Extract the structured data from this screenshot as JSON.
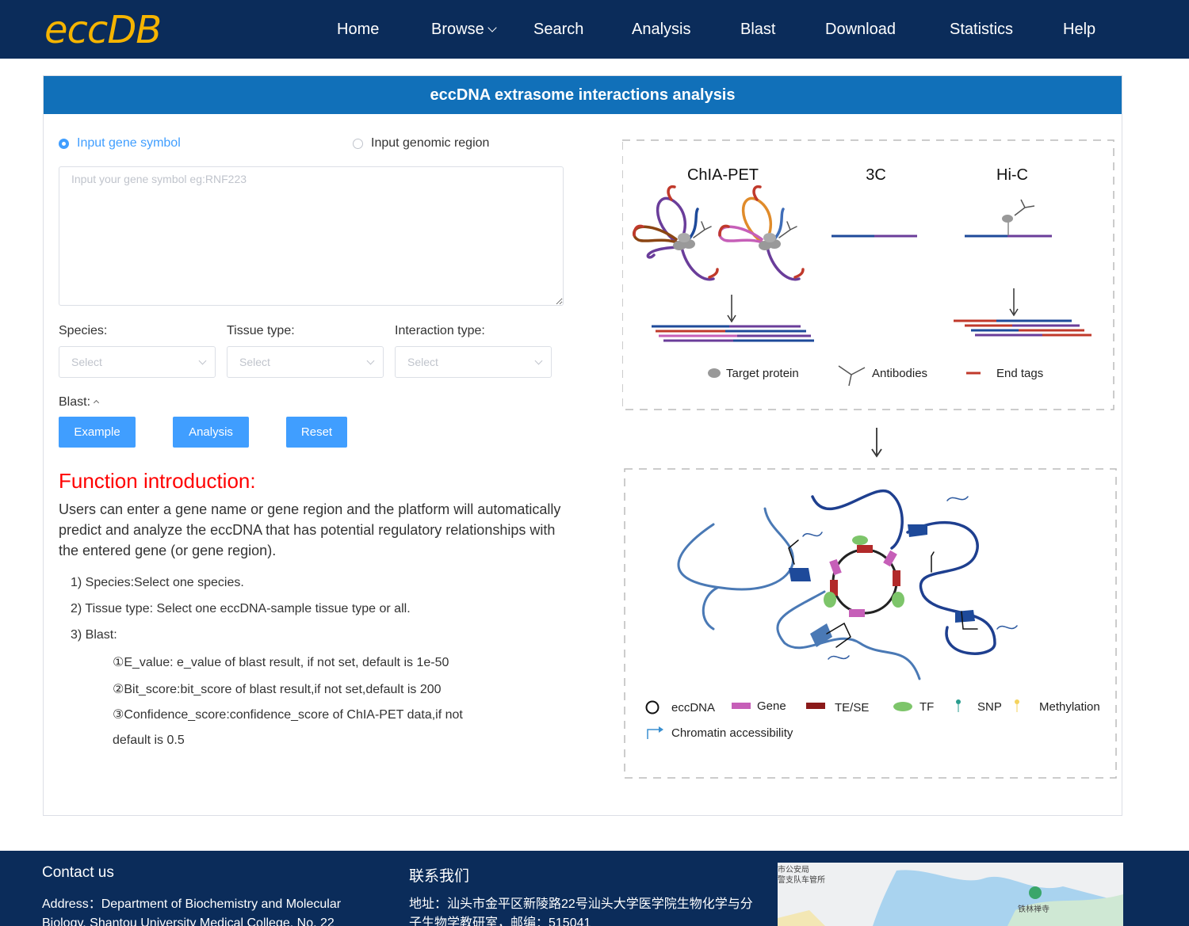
{
  "nav": {
    "logo": "eccDB",
    "items": [
      "Home",
      "Browse",
      "Search",
      "Analysis",
      "Blast",
      "Download",
      "Statistics",
      "Help"
    ]
  },
  "panel": {
    "title": "eccDNA extrasome interactions analysis",
    "radio_gene": "Input gene symbol",
    "radio_region": "Input genomic region",
    "textarea_placeholder": "Input your gene symbol eg:RNF223",
    "species_label": "Species:",
    "tissue_label": "Tissue type:",
    "interaction_label": "Interaction type:",
    "select_placeholder": "Select",
    "blast_label": "Blast:",
    "btn_example": "Example",
    "btn_analysis": "Analysis",
    "btn_reset": "Reset",
    "func_title": "Function introduction:",
    "func_desc": "Users can enter a gene name or gene region and the platform will automatically predict and analyze the eccDNA that has potential regulatory relationships with the entered gene (or gene region).",
    "func_items": [
      "1) Species:Select one species.",
      "2) Tissue type: Select one eccDNA-sample tissue type or all.",
      "3) Blast:",
      "①E_value: e_value of blast result, if not set, default is 1e-50",
      "②Bit_score:bit_score of blast result,if not set,default is 200",
      "③Confidence_score:confidence_score of ChIA-PET data,if not",
      "default is 0.5"
    ]
  },
  "figure": {
    "methods": [
      "ChIA-PET",
      "3C",
      "Hi-C"
    ],
    "legend_top": [
      "Target protein",
      "Antibodies",
      "End tags"
    ],
    "legend_bottom": [
      "eccDNA",
      "Gene",
      "TE/SE",
      "TF",
      "SNP",
      "Methylation",
      "Chromatin accessibility"
    ],
    "colors": {
      "red": "#b22a2a",
      "blue": "#1e4a9a",
      "purple": "#6a3d9a",
      "pink": "#c65fb8",
      "green": "#7dc56a"
    }
  },
  "footer": {
    "contact_title": "Contact us",
    "address": "Address：Department of Biochemistry and Molecular",
    "address2": "Biology, Shantou University Medical College, No. 22",
    "cn_title": "联系我们",
    "cn_address": "地址：汕头市金平区新陵路22号汕头大学医学院生物化学与分",
    "cn_address2": "子生物学教研室，邮编：515041",
    "map_label_1": "市公安局",
    "map_label_2": "警支队车管所",
    "map_label_3": "铁林禅寺"
  }
}
